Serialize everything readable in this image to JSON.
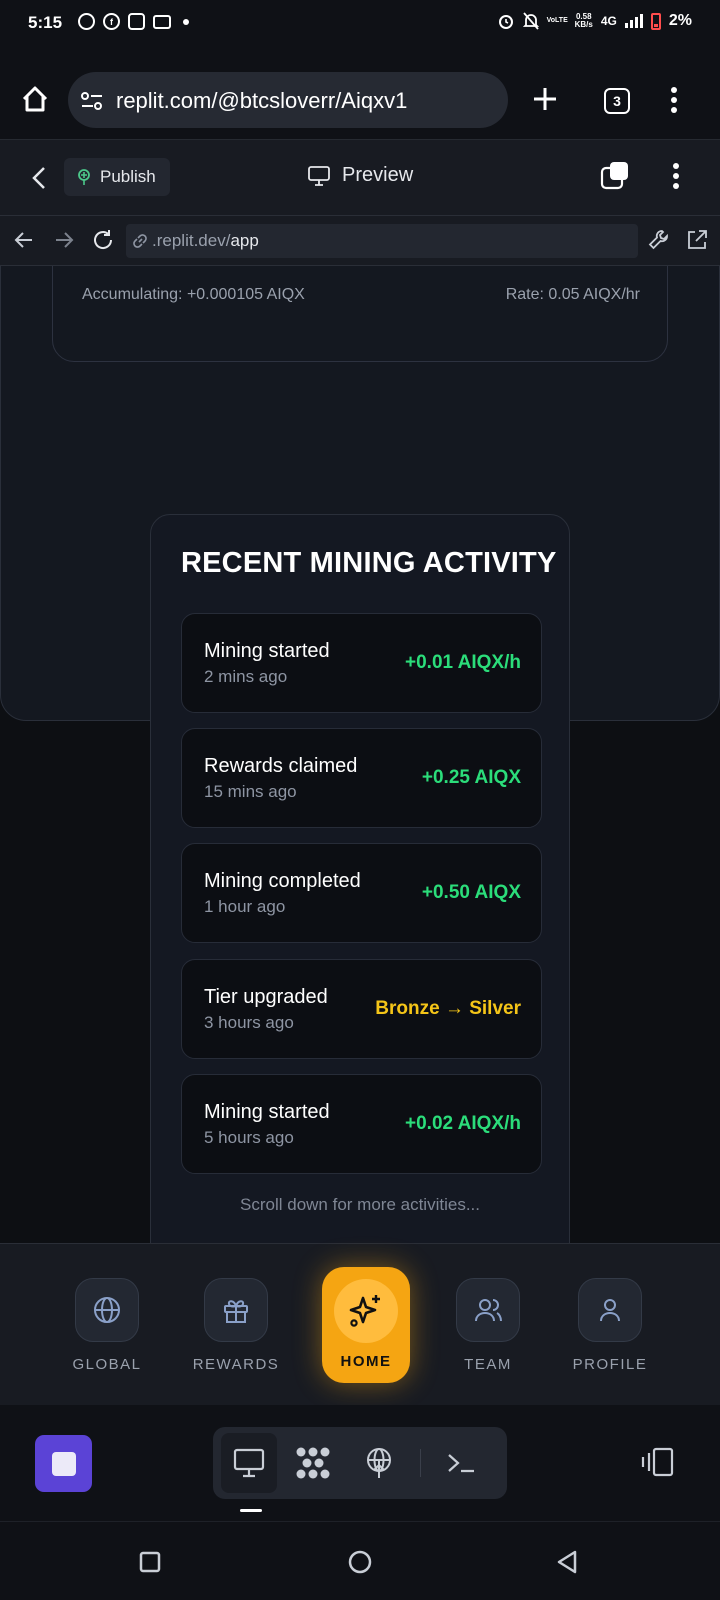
{
  "status_bar": {
    "time": "5:15",
    "net_speed_value": "0.58",
    "net_speed_unit": "KB/s",
    "volte": "VoLTE",
    "network": "4G",
    "battery": "2%"
  },
  "browser": {
    "url": "replit.com/@btcsloverr/Aiqxv1",
    "tab_count": "3"
  },
  "replit_header": {
    "publish_label": "Publish",
    "preview_label": "Preview"
  },
  "webview": {
    "url_prefix": ".replit.dev/",
    "url_path": "app"
  },
  "mining_card": {
    "accumulating": "Accumulating: +0.000105 AIQX",
    "rate": "Rate: 0.05 AIQX/hr"
  },
  "activity": {
    "title": "RECENT MINING ACTIVITY",
    "items": [
      {
        "title": "Mining started",
        "time": "2 mins ago",
        "value": "+0.01 AIQX/h",
        "color": "#2bdd7a"
      },
      {
        "title": "Rewards claimed",
        "time": "15 mins ago",
        "value": "+0.25 AIQX",
        "color": "#2bdd7a"
      },
      {
        "title": "Mining completed",
        "time": "1 hour ago",
        "value": "+0.50 AIQX",
        "color": "#2bdd7a"
      },
      {
        "title": "Tier upgraded",
        "time": "3 hours ago",
        "value": "Bronze → Silver",
        "color": "#f5c518"
      },
      {
        "title": "Mining started",
        "time": "5 hours ago",
        "value": "+0.02 AIQX/h",
        "color": "#2bdd7a"
      }
    ],
    "scroll_hint": "Scroll down for more activities..."
  },
  "bottom_nav": {
    "items": [
      {
        "label": "GLOBAL",
        "icon": "globe-icon"
      },
      {
        "label": "REWARDS",
        "icon": "gift-icon"
      },
      {
        "label": "HOME",
        "icon": "sparkle-icon",
        "active": true
      },
      {
        "label": "TEAM",
        "icon": "users-icon"
      },
      {
        "label": "PROFILE",
        "icon": "user-icon"
      }
    ]
  },
  "colors": {
    "accent": "#f5a512",
    "positive": "#2bdd7a",
    "tier": "#f5c518",
    "replit_stop": "#5b43d6"
  }
}
